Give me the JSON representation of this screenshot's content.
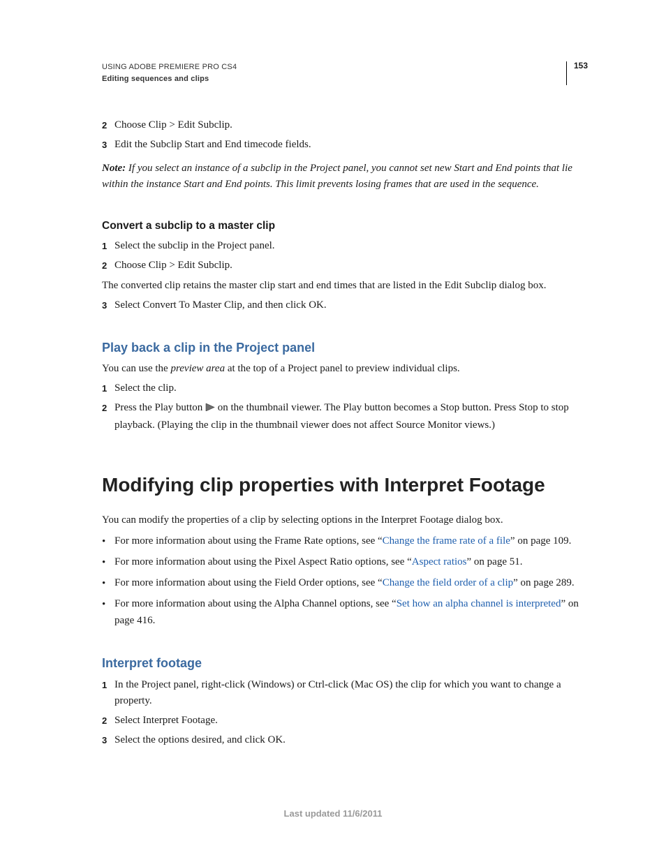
{
  "header": {
    "line1": "USING ADOBE PREMIERE PRO CS4",
    "line2": "Editing sequences and clips",
    "page_number": "153"
  },
  "top_steps": [
    {
      "n": "2",
      "text": "Choose Clip > Edit Subclip."
    },
    {
      "n": "3",
      "text": "Edit the Subclip Start and End timecode fields."
    }
  ],
  "note": {
    "label": "Note:",
    "text": " If you select an instance of a subclip in the Project panel, you cannot set new Start and End points that lie within the instance Start and End points. This limit prevents losing frames that are used in the sequence."
  },
  "sec_convert": {
    "title": "Convert a subclip to a master clip",
    "steps_a": [
      {
        "n": "1",
        "text": "Select the subclip in the Project panel."
      },
      {
        "n": "2",
        "text": "Choose Clip > Edit Subclip."
      }
    ],
    "mid_para": "The converted clip retains the master clip start and end times that are listed in the Edit Subclip dialog box.",
    "steps_b": [
      {
        "n": "3",
        "text": "Select Convert To Master Clip, and then click OK."
      }
    ]
  },
  "sec_playback": {
    "title": "Play back a clip in the Project panel",
    "intro_pre": "You can use the ",
    "intro_em": "preview area",
    "intro_post": " at the top of a Project panel to preview individual clips.",
    "steps": {
      "s1": {
        "n": "1",
        "text": "Select the clip."
      },
      "s2": {
        "n": "2",
        "pre": "Press the Play button ",
        "post": " on the thumbnail viewer. The Play button becomes a Stop button. Press Stop to stop playback. (Playing the clip in the thumbnail viewer does not affect Source Monitor views.)"
      }
    }
  },
  "sec_modify": {
    "h1": "Modifying clip properties with Interpret Footage",
    "intro": "You can modify the properties of a clip by selecting options in the Interpret Footage dialog box.",
    "bullets": [
      {
        "pre": "For more information about using the Frame Rate options, see “",
        "link": "Change the frame rate of a file",
        "post": "” on page 109."
      },
      {
        "pre": "For more information about using the Pixel Aspect Ratio options, see “",
        "link": "Aspect ratios",
        "post": "” on page 51."
      },
      {
        "pre": "For more information about using the Field Order options, see “",
        "link": "Change the field order of a clip",
        "post": "” on page 289."
      },
      {
        "pre": "For more information about using the Alpha Channel options, see “",
        "link": "Set how an alpha channel is interpreted",
        "post": "” on page 416."
      }
    ]
  },
  "sec_interpret": {
    "title": "Interpret footage",
    "steps": [
      {
        "n": "1",
        "text": "In the Project panel, right-click (Windows) or Ctrl-click (Mac OS) the clip for which you want to change a property."
      },
      {
        "n": "2",
        "text": "Select Interpret Footage."
      },
      {
        "n": "3",
        "text": "Select the options desired, and click OK."
      }
    ]
  },
  "footer": "Last updated 11/6/2011"
}
